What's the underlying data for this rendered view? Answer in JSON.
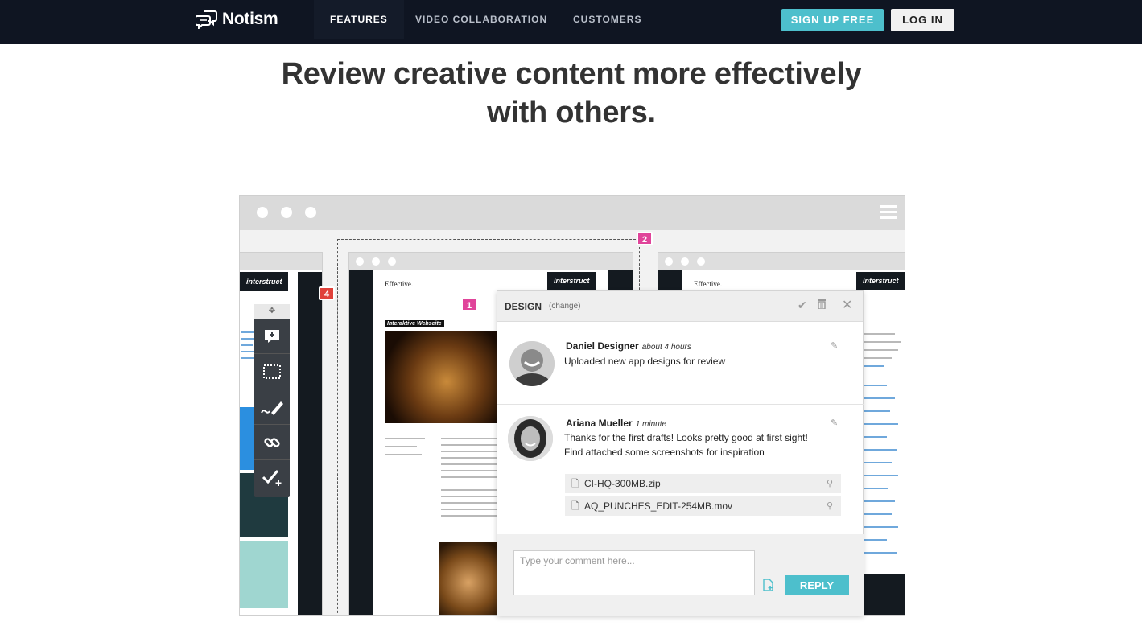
{
  "nav": {
    "logo_text": "Notism",
    "links": [
      "FEATURES",
      "VIDEO COLLABORATION",
      "CUSTOMERS"
    ],
    "signup_label": "SIGN UP FREE",
    "login_label": "LOG IN"
  },
  "hero": {
    "headline_line1": "Review creative content more effectively",
    "headline_line2": "with others."
  },
  "mock": {
    "site_brand": "interstruct",
    "site_title": "Effective.",
    "site_banner": "Interaktive Webseite",
    "markers": [
      "1",
      "2",
      "4"
    ]
  },
  "panel": {
    "title": "DESIGN",
    "change_label": "(change)",
    "comments": [
      {
        "author": "Daniel Designer",
        "time": "about 4 hours",
        "text": "Uploaded new app designs for review"
      },
      {
        "author": "Ariana Mueller",
        "time": "1 minute",
        "text_line1": "Thanks for the first drafts! Looks pretty good at first sight!",
        "text_line2": "Find attached some screenshots for inspiration",
        "attachments": [
          "CI-HQ-300MB.zip",
          "AQ_PUNCHES_EDIT-254MB.mov"
        ]
      }
    ],
    "comment_placeholder": "Type your comment here...",
    "reply_label": "REPLY"
  },
  "colors": {
    "nav_bg": "#0f1522",
    "accent": "#4dbfcc",
    "marker_pink": "#e0449a",
    "marker_red": "#e0413a"
  }
}
